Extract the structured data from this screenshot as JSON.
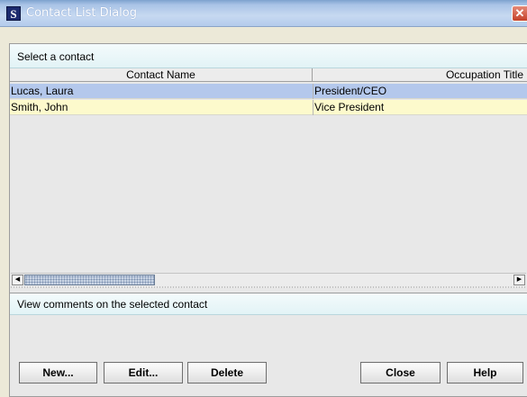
{
  "window": {
    "title": "Contact List Dialog",
    "app_icon": "S",
    "close_glyph": "✕"
  },
  "contacts_panel": {
    "header": "Select a contact",
    "columns": [
      "Contact Name",
      "Occupation Title"
    ],
    "rows": [
      {
        "name": "Lucas, Laura",
        "title": "President/CEO",
        "bg": "#b4c8ec"
      },
      {
        "name": "Smith, John",
        "title": "Vice President",
        "bg": "#fdfacc"
      }
    ],
    "scroll_left": "◀",
    "scroll_right": "▶"
  },
  "comments_panel": {
    "header": "View comments on the selected contact"
  },
  "buttons": {
    "new": "New...",
    "edit": "Edit...",
    "delete": "Delete",
    "close": "Close",
    "help": "Help"
  },
  "colors": {
    "selected_row": "#b4c8ec",
    "alt_row": "#fdfacc",
    "title_text": "#ffffff"
  }
}
